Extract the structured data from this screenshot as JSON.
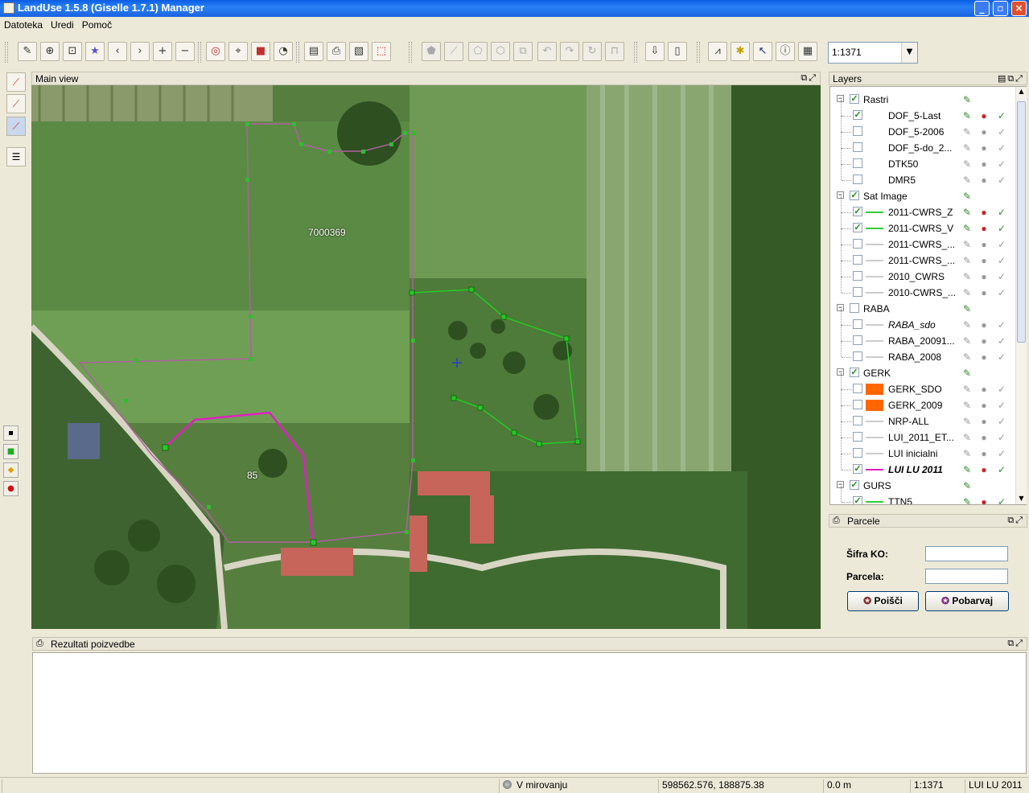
{
  "window": {
    "title": "LandUse 1.5.8 (Giselle 1.7.1) Manager",
    "min_icon": "minimize-icon",
    "max_icon": "maximize-icon",
    "close_icon": "close-icon"
  },
  "menu": [
    "Datoteka",
    "Uredi",
    "Pomoč"
  ],
  "toolbar": {
    "scale": "1:1371",
    "icons": [
      "pencil-icon",
      "globe-zoom-icon",
      "zoom-extent-icon",
      "favorite-star-icon",
      "back-arrow-icon",
      "forward-arrow-icon",
      "zoom-in-icon",
      "zoom-out-icon",
      "navigate-icon",
      "goto-xy-icon",
      "select-rect-icon",
      "measure-icon",
      "document-icon",
      "print-icon",
      "print-preview-icon",
      "pdf-export-icon",
      "edit-polygon-icon",
      "edit-line-icon",
      "cut-polygon-icon",
      "merge-icon",
      "split-icon",
      "undo-icon",
      "redo-icon",
      "refresh-icon",
      "lock-icon",
      "import-icon",
      "new-document-icon",
      "chart-icon",
      "identify-tool-icon",
      "info-pointer-icon",
      "info-icon",
      "table-icon"
    ]
  },
  "map_panel": {
    "title": "Main view",
    "labels": [
      "7000369",
      "85"
    ]
  },
  "layers_panel": {
    "title": "Layers",
    "rows": [
      {
        "kind": "group",
        "name": "Rastri",
        "checked": true
      },
      {
        "kind": "item",
        "name": "DOF_5-Last",
        "checked": true
      },
      {
        "kind": "item",
        "name": "DOF_5-2006",
        "checked": false
      },
      {
        "kind": "item",
        "name": "DOF_5-do_2...",
        "checked": false
      },
      {
        "kind": "item",
        "name": "DTK50",
        "checked": false
      },
      {
        "kind": "item",
        "name": "DMR5",
        "checked": false
      },
      {
        "kind": "group",
        "name": "Sat Image",
        "checked": true
      },
      {
        "kind": "item",
        "name": "2011-CWRS_Z",
        "checked": true,
        "swatch": "#33cc33"
      },
      {
        "kind": "item",
        "name": "2011-CWRS_V",
        "checked": true,
        "swatch": "#33cc33"
      },
      {
        "kind": "item",
        "name": "2011-CWRS_...",
        "checked": false,
        "swatch": "#cccccc"
      },
      {
        "kind": "item",
        "name": "2011-CWRS_...",
        "checked": false,
        "swatch": "#cccccc"
      },
      {
        "kind": "item",
        "name": "2010_CWRS",
        "checked": false,
        "swatch": "#cccccc"
      },
      {
        "kind": "item",
        "name": "2010-CWRS_...",
        "checked": false,
        "swatch": "#cccccc"
      },
      {
        "kind": "group",
        "name": "RABA",
        "checked": false
      },
      {
        "kind": "item",
        "name": "RABA_sdo",
        "checked": false,
        "swatch": "#cccccc",
        "italic": true
      },
      {
        "kind": "item",
        "name": "RABA_20091...",
        "checked": false,
        "swatch": "#cccccc"
      },
      {
        "kind": "item",
        "name": "RABA_2008",
        "checked": false,
        "swatch": "#cccccc"
      },
      {
        "kind": "group",
        "name": "GERK",
        "checked": true
      },
      {
        "kind": "item",
        "name": "GERK_SDO",
        "checked": false,
        "swatch": "#ff6600",
        "fill": true
      },
      {
        "kind": "item",
        "name": "GERK_2009",
        "checked": false,
        "swatch": "#ff6600",
        "fill": true
      },
      {
        "kind": "item",
        "name": "NRP-ALL",
        "checked": false,
        "swatch": "#cccccc"
      },
      {
        "kind": "item",
        "name": "LUI_2011_ET...",
        "checked": false,
        "swatch": "#cccccc"
      },
      {
        "kind": "item",
        "name": "LUI inicialni",
        "checked": false,
        "swatch": "#cccccc"
      },
      {
        "kind": "item",
        "name": "LUI LU 2011",
        "checked": true,
        "swatch": "#e020c0",
        "bold": true
      },
      {
        "kind": "group",
        "name": "GURS",
        "checked": true
      },
      {
        "kind": "item",
        "name": "TTN5",
        "checked": true,
        "swatch": "#33cc33"
      }
    ]
  },
  "parcele_panel": {
    "title": "Parcele",
    "sifra_label": "Šifra KO:",
    "parcela_label": "Parcela:",
    "sifra_value": "",
    "parcela_value": "",
    "search_button": "Poišči",
    "color_button": "Pobarvaj"
  },
  "results_panel": {
    "title": "Rezultati poizvedbe"
  },
  "status": {
    "state": "V mirovanju",
    "coords": "598562.576, 188875.38",
    "distance": "0.0 m",
    "scale": "1:1371",
    "active_layer": "LUI LU 2011"
  }
}
